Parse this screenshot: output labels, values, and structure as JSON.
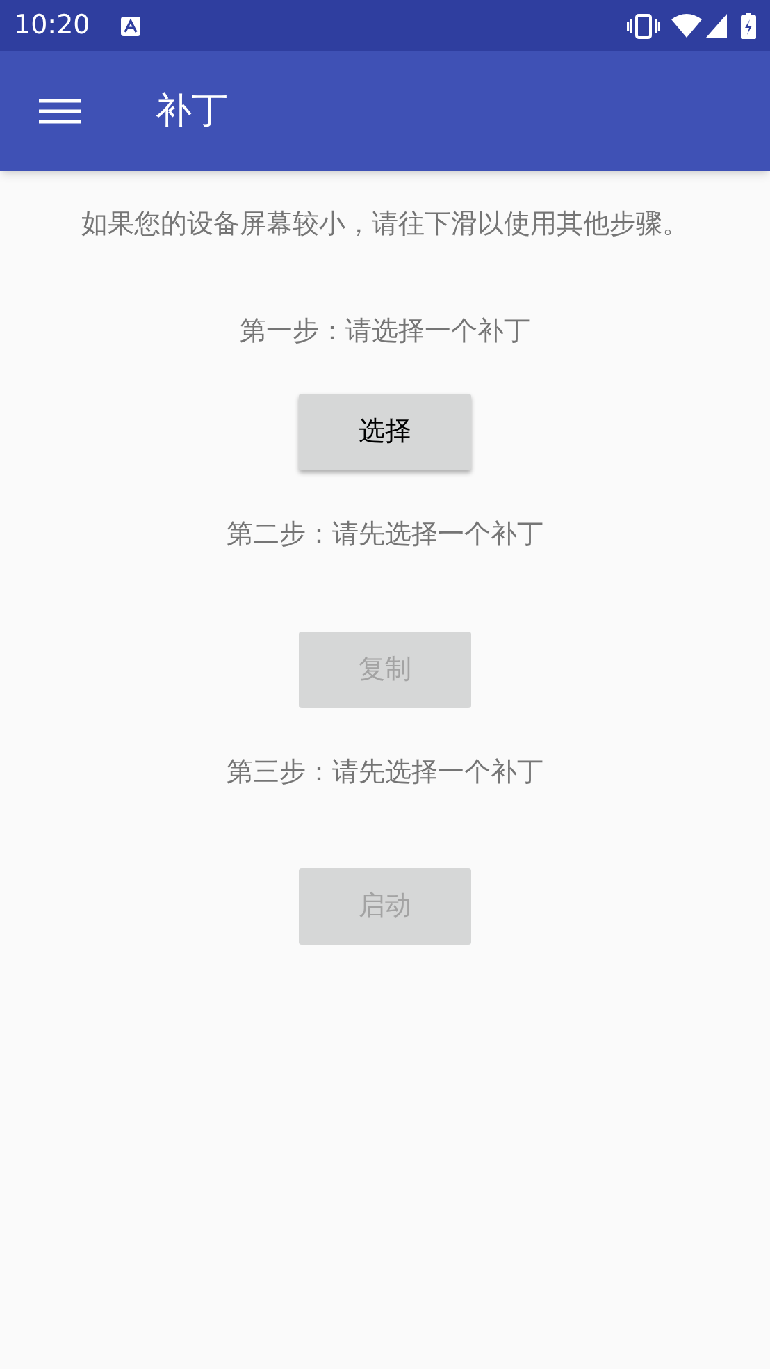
{
  "status_bar": {
    "time": "10:20"
  },
  "app_bar": {
    "title": "补丁"
  },
  "notice": "如果您的设备屏幕较小，请往下滑以使用其他步骤。",
  "steps": [
    {
      "label": "第一步：请选择一个补丁",
      "button": {
        "label": "选择",
        "disabled": false
      }
    },
    {
      "label": "第二步：请先选择一个补丁",
      "button": {
        "label": "复制",
        "disabled": true
      }
    },
    {
      "label": "第三步：请先选择一个补丁",
      "button": {
        "label": "启动",
        "disabled": true
      }
    }
  ]
}
